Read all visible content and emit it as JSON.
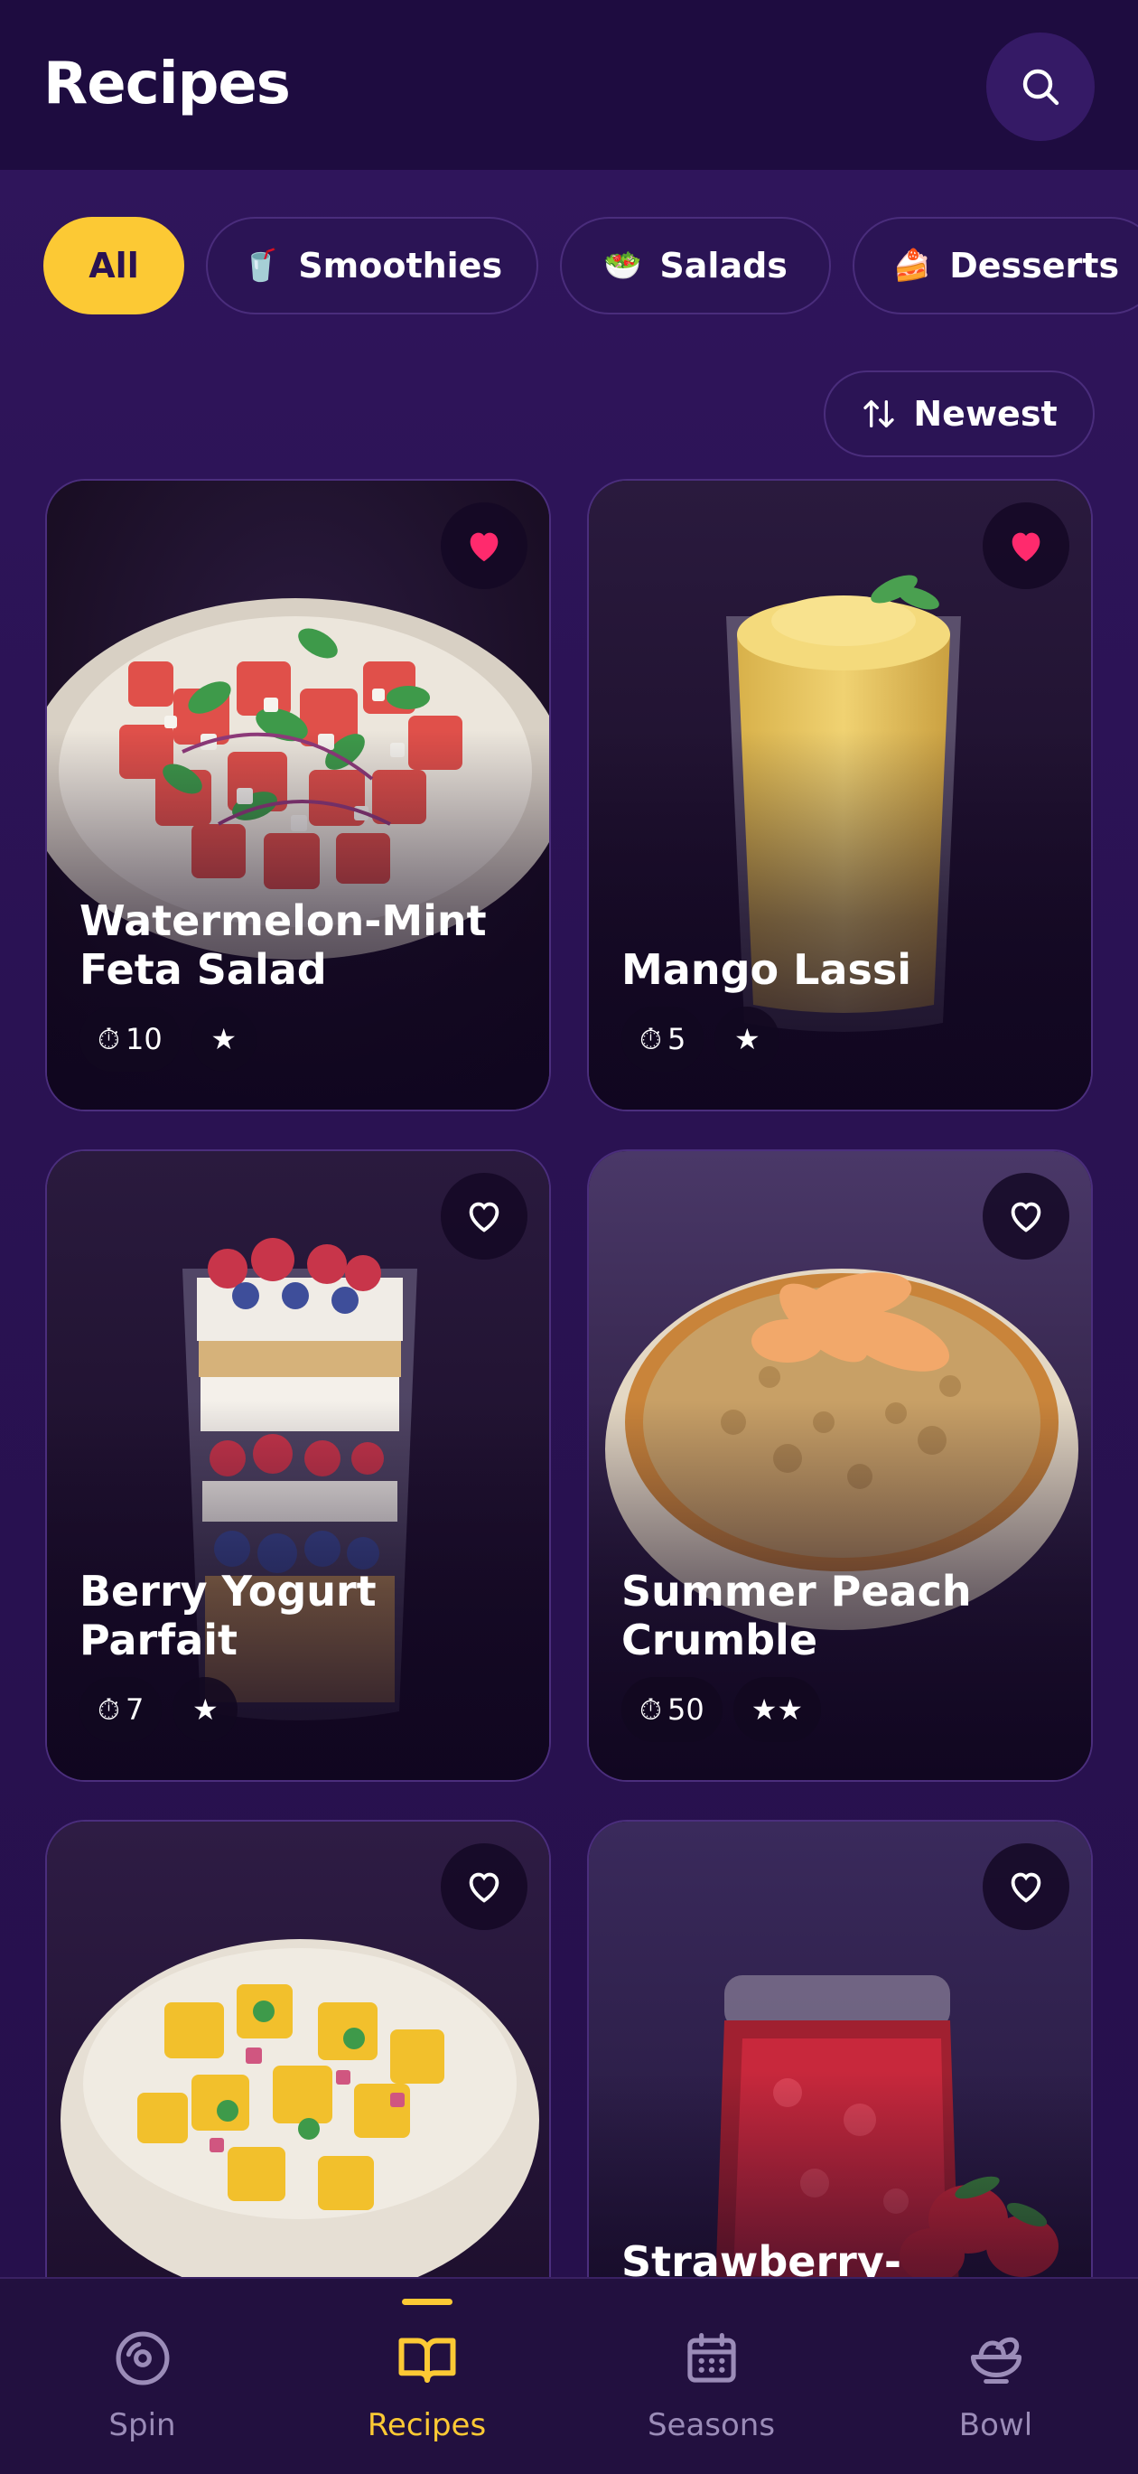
{
  "header": {
    "title": "Recipes",
    "search_icon": "search-icon"
  },
  "categories": [
    {
      "label": "All",
      "emoji": "",
      "active": true
    },
    {
      "label": "Smoothies",
      "emoji": "🥤",
      "active": false
    },
    {
      "label": "Salads",
      "emoji": "🥗",
      "active": false
    },
    {
      "label": "Desserts",
      "emoji": "🍰",
      "active": false
    }
  ],
  "sort": {
    "label": "Newest",
    "icon": "sort-icon"
  },
  "recipes": [
    {
      "title": "Watermelon-Mint Feta Salad",
      "time": "10",
      "stars": "★",
      "favorite": true
    },
    {
      "title": "Mango Lassi",
      "time": "5",
      "stars": "★",
      "favorite": true
    },
    {
      "title": "Berry Yogurt Parfait",
      "time": "7",
      "stars": "★",
      "favorite": false
    },
    {
      "title": "Summer Peach Crumble",
      "time": "50",
      "stars": "★★",
      "favorite": false
    },
    {
      "title": "",
      "time": "",
      "stars": "",
      "favorite": false
    },
    {
      "title": "Strawberry-",
      "time": "",
      "stars": "",
      "favorite": false
    }
  ],
  "timer_icon": "⏱",
  "nav": [
    {
      "label": "Spin",
      "icon": "spin-disc-icon",
      "active": false
    },
    {
      "label": "Recipes",
      "icon": "book-icon",
      "active": true
    },
    {
      "label": "Seasons",
      "icon": "calendar-icon",
      "active": false
    },
    {
      "label": "Bowl",
      "icon": "bowl-icon",
      "active": false
    }
  ],
  "colors": {
    "accent": "#fcc934",
    "heart": "#ff2a6d",
    "background": "#2a1252",
    "header": "#1e0c40"
  }
}
